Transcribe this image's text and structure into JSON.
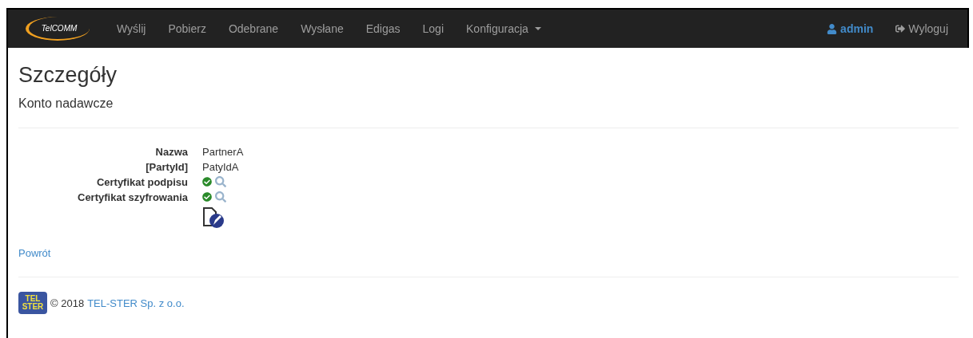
{
  "navbar": {
    "logo": "TelCOMM",
    "items": [
      {
        "label": "Wyślij",
        "dropdown": false
      },
      {
        "label": "Pobierz",
        "dropdown": false
      },
      {
        "label": "Odebrane",
        "dropdown": false
      },
      {
        "label": "Wysłane",
        "dropdown": false
      },
      {
        "label": "Edigas",
        "dropdown": false
      },
      {
        "label": "Logi",
        "dropdown": false
      },
      {
        "label": "Konfiguracja",
        "dropdown": true
      }
    ],
    "user": "admin",
    "logout": "Wyloguj"
  },
  "page": {
    "title": "Szczegóły",
    "subtitle": "Konto nadawcze"
  },
  "details": [
    {
      "kind": "text",
      "label": "Nazwa",
      "value": "PartnerA"
    },
    {
      "kind": "text",
      "label": "[PartyId]",
      "value": "PatyIdA"
    },
    {
      "kind": "certificate",
      "label": "Certyfikat podpisu",
      "valid": true
    },
    {
      "kind": "certificate",
      "label": "Certyfikat szyfrowania",
      "valid": true
    }
  ],
  "back_link": "Powrót",
  "footer": {
    "logo_lines": [
      "TEL",
      "STER"
    ],
    "copyright": "© 2018",
    "company": "TEL-STER Sp. z o.o."
  }
}
